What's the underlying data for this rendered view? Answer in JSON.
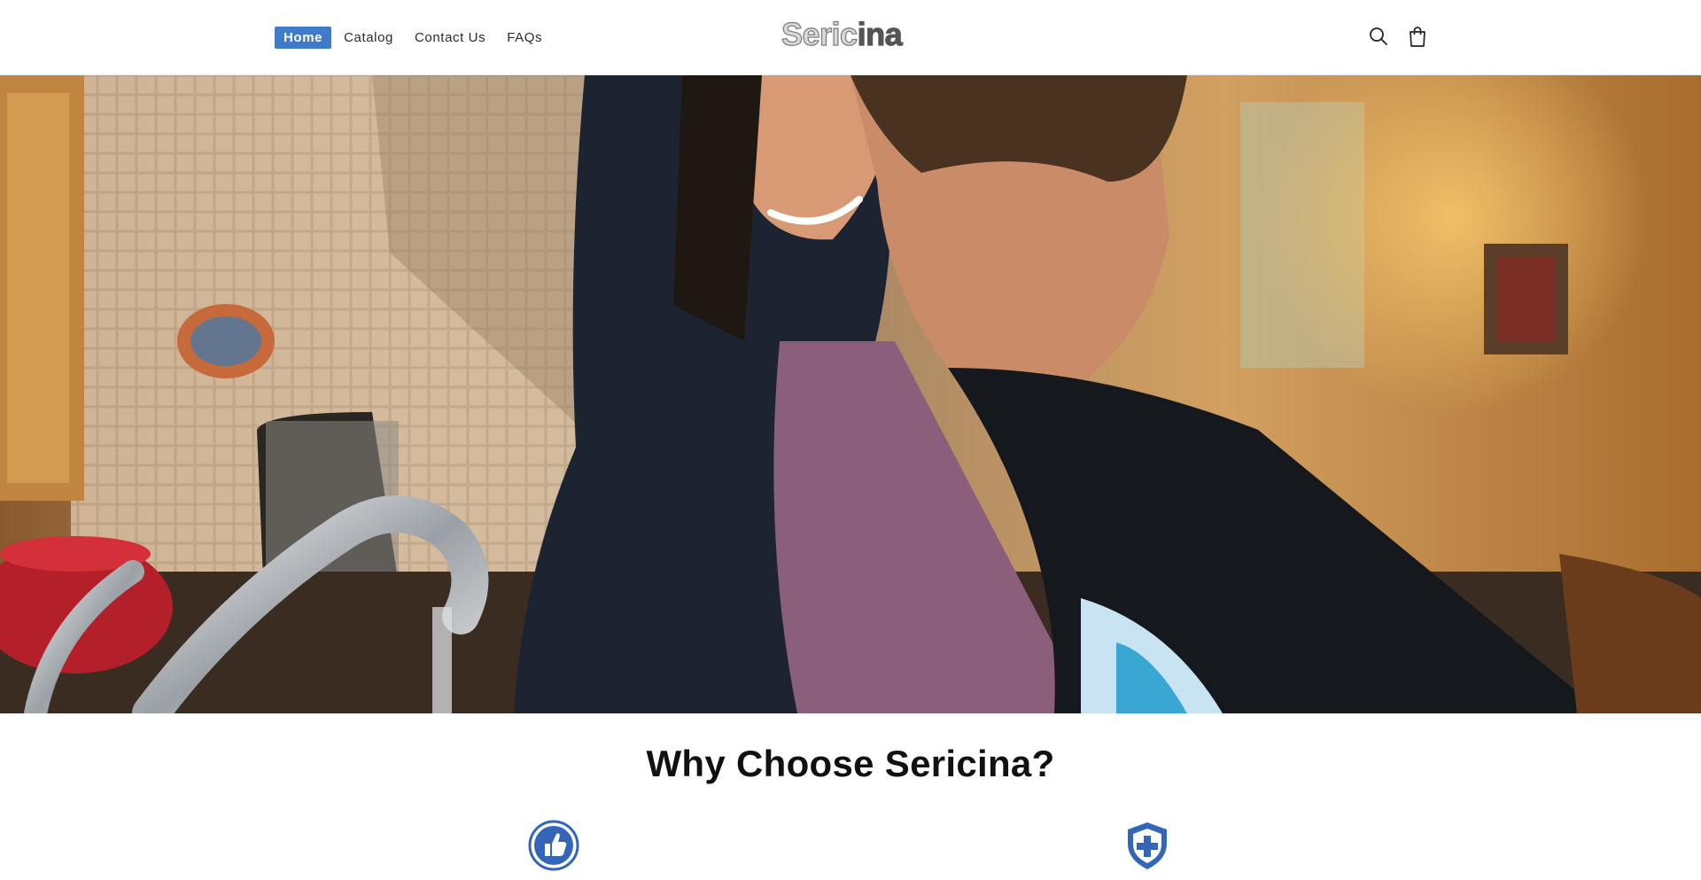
{
  "header": {
    "nav": [
      {
        "label": "Home",
        "active": true
      },
      {
        "label": "Catalog",
        "active": false
      },
      {
        "label": "Contact Us",
        "active": false
      },
      {
        "label": "FAQs",
        "active": false
      }
    ],
    "logo_text": "Sericina",
    "icons": {
      "search": "search-icon",
      "cart": "shopping-bag-icon"
    }
  },
  "hero": {
    "image": "mother-and-son-washing-at-kitchen-sink"
  },
  "why": {
    "title": "Why Choose Sericina?",
    "features": [
      {
        "icon": "thumbs-up-icon"
      },
      {
        "icon": "shield-plus-icon"
      }
    ]
  },
  "colors": {
    "accent": "#3f7bc9",
    "icon_blue": "#3366b8",
    "text": "#111111"
  }
}
